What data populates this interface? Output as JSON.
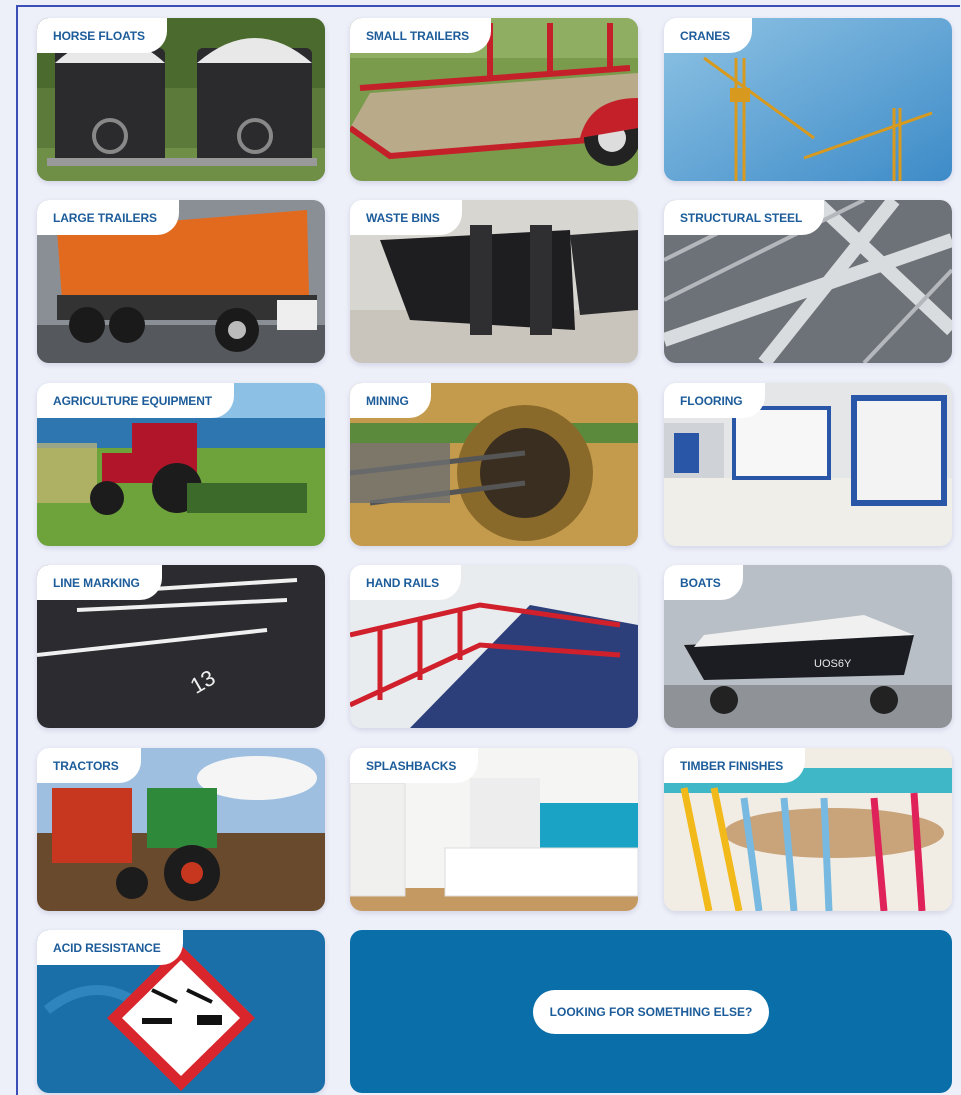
{
  "categories": [
    {
      "label": "HORSE FLOATS"
    },
    {
      "label": "SMALL TRAILERS"
    },
    {
      "label": "CRANES"
    },
    {
      "label": "LARGE TRAILERS"
    },
    {
      "label": "WASTE BINS"
    },
    {
      "label": "STRUCTURAL STEEL"
    },
    {
      "label": "AGRICULTURE EQUIPMENT"
    },
    {
      "label": "MINING"
    },
    {
      "label": "FLOORING"
    },
    {
      "label": "LINE MARKING"
    },
    {
      "label": "HAND RAILS"
    },
    {
      "label": "BOATS"
    },
    {
      "label": "TRACTORS"
    },
    {
      "label": "SPLASHBACKS"
    },
    {
      "label": "TIMBER FINISHES"
    },
    {
      "label": "ACID RESISTANCE"
    }
  ],
  "cta": {
    "label": "LOOKING FOR SOMETHING ELSE?"
  },
  "colors": {
    "tab_text": "#1c5c9a",
    "cta_background": "#0a6ea8",
    "page_background": "#eef0f9",
    "frame_border": "#3c4fb8"
  }
}
